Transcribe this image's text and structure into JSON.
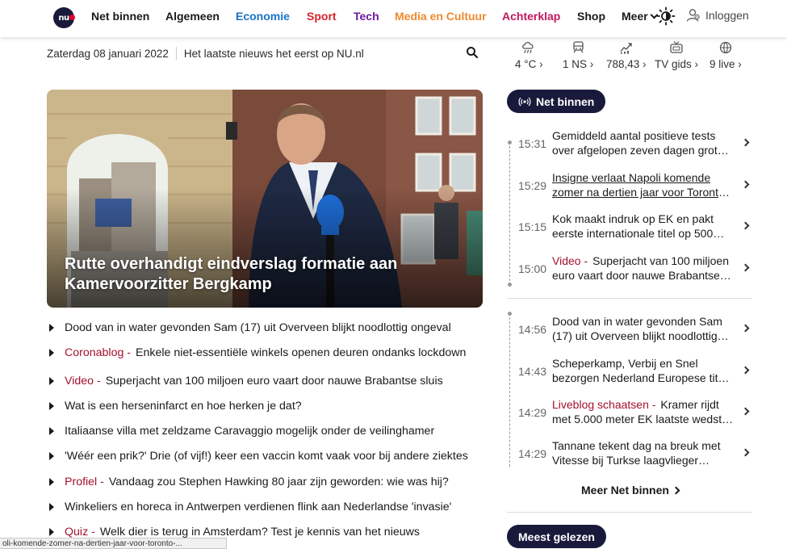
{
  "nav": {
    "logo_text": "nu",
    "items": [
      {
        "label": "Net binnen",
        "color": "#1a1a1a"
      },
      {
        "label": "Algemeen",
        "color": "#1a1a1a"
      },
      {
        "label": "Economie",
        "color": "#1a73c6"
      },
      {
        "label": "Sport",
        "color": "#d8232a"
      },
      {
        "label": "Tech",
        "color": "#6b1a9b"
      },
      {
        "label": "Media en Cultuur",
        "color": "#ee8a2f"
      },
      {
        "label": "Achterklap",
        "color": "#c2185b"
      },
      {
        "label": "Shop",
        "color": "#1a1a1a"
      },
      {
        "label": "Meer",
        "color": "#1a1a1a"
      }
    ],
    "login_label": "Inloggen"
  },
  "datebar": {
    "date": "Zaterdag 08 januari 2022",
    "tagline": "Het laatste nieuws het eerst op NU.nl"
  },
  "widgets": [
    {
      "icon": "weather-icon",
      "value": "4 °C"
    },
    {
      "icon": "train-icon",
      "value": "1 NS"
    },
    {
      "icon": "stock-chart-icon",
      "value": "788,43"
    },
    {
      "icon": "tv-icon",
      "value": "TV gids"
    },
    {
      "icon": "live-icon",
      "value": "9 live"
    }
  ],
  "hero": {
    "title": "Rutte overhandigt eindverslag formatie aan Kamervoorzitter Bergkamp"
  },
  "headlines": [
    {
      "tag": "",
      "text": "Dood van in water gevonden Sam (17) uit Overveen blijkt noodlottig ongeval"
    },
    {
      "tag": "Coronablog -",
      "text": "Enkele niet-essentiële winkels openen deuren ondanks lockdown"
    },
    {
      "tag": "Video -",
      "text": "Superjacht van 100 miljoen euro vaart door nauwe Brabantse sluis"
    },
    {
      "tag": "",
      "text": "Wat is een herseninfarct en hoe herken je dat?"
    },
    {
      "tag": "",
      "text": "Italiaanse villa met zeldzame Caravaggio mogelijk onder de veilinghamer"
    },
    {
      "tag": "",
      "text": "'Wéér een prik?' Drie (of vijf!) keer een vaccin komt vaak voor bij andere ziektes"
    },
    {
      "tag": "Profiel -",
      "text": "Vandaag zou Stephen Hawking 80 jaar zijn geworden: wie was hij?"
    },
    {
      "tag": "",
      "text": "Winkeliers en horeca in Antwerpen verdienen flink aan Nederlandse 'invasie'"
    },
    {
      "tag": "Quiz -",
      "text": "Welk dier is terug in Amsterdam? Test je kennis van het nieuws"
    }
  ],
  "net_binnen": {
    "title": "Net binnen",
    "group1": [
      {
        "time": "15:31",
        "tag": "",
        "line1": "Gemiddeld aantal positieve tests",
        "line2": "over afgelopen zeven dagen groter…"
      },
      {
        "time": "15:29",
        "tag": "",
        "line1": "Insigne verlaat Napoli komende",
        "line2": "zomer na dertien jaar voor Toronto…"
      },
      {
        "time": "15:15",
        "tag": "",
        "line1": "Kok maakt indruk op EK en pakt",
        "line2": "eerste internationale titel op 500…"
      },
      {
        "time": "15:00",
        "tag": "Video -",
        "line1": "Superjacht van 100 miljoen",
        "line2": "euro vaart door nauwe Brabantse…"
      }
    ],
    "group2": [
      {
        "time": "14:56",
        "tag": "",
        "line1": "Dood van in water gevonden Sam",
        "line2": "(17) uit Overveen blijkt noodlottig…"
      },
      {
        "time": "14:43",
        "tag": "",
        "line1": "Scheperkamp, Verbij en Snel",
        "line2": "bezorgen Nederland Europese titel…"
      },
      {
        "time": "14:29",
        "tag": "Liveblog schaatsen -",
        "line1": "Kramer rijdt",
        "line2": "met 5.000 meter EK laatste wedstri…"
      },
      {
        "time": "14:29",
        "tag": "",
        "line1": "Tannane tekent dag na breuk met",
        "line2": "Vitesse bij Turkse laagvlieger…"
      }
    ],
    "more_label": "Meer Net binnen"
  },
  "meest_gelezen": {
    "title": "Meest gelezen"
  },
  "statusbar": {
    "url": "oli-komende-zomer-na-dertien-jaar-voor-toronto-..."
  },
  "colors": {
    "navy": "#191a3b",
    "red_tag": "#a4102c"
  }
}
